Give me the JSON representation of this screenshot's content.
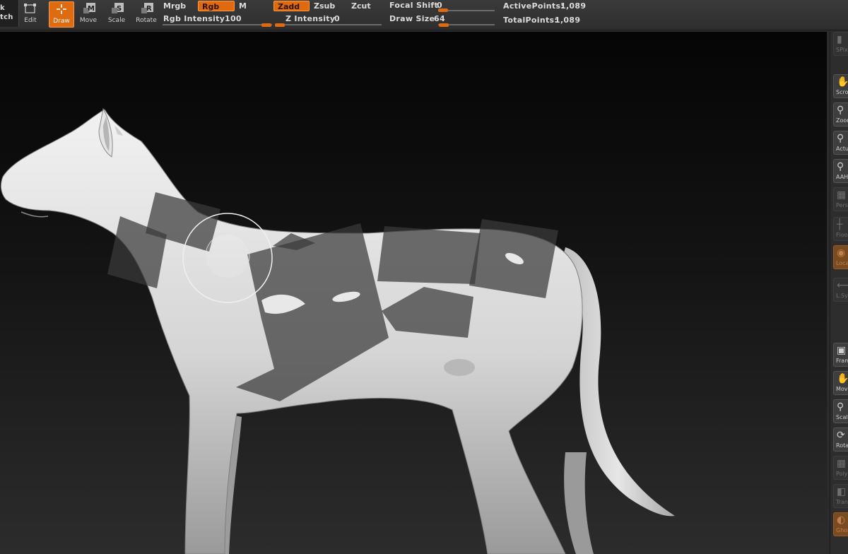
{
  "toolbar": {
    "lightbox_partial": "k",
    "sketch_partial": "tch",
    "tools": [
      {
        "label": "Edit",
        "active": false
      },
      {
        "label": "Draw",
        "active": true
      },
      {
        "label": "Move",
        "letter": "M",
        "active": false
      },
      {
        "label": "Scale",
        "letter": "S",
        "active": false
      },
      {
        "label": "Rotate",
        "letter": "R",
        "active": false
      }
    ],
    "mrgb": "Mrgb",
    "rgb": "Rgb",
    "m": "M",
    "zadd": "Zadd",
    "zsub": "Zsub",
    "zcut": "Zcut",
    "rgb_intensity": {
      "label": "Rgb  Intensity",
      "value": "100",
      "fraction": 1.0
    },
    "z_intensity": {
      "label": "Z  Intensity",
      "value": "0",
      "fraction": 0.0
    },
    "focal_shift": {
      "label": "Focal  Shift",
      "value": "0",
      "fraction": 0.0
    },
    "draw_size": {
      "label": "Draw  Size",
      "value": "64",
      "fraction": 0.05
    },
    "active_points": {
      "label": "ActivePoints:",
      "value": "1,089"
    },
    "total_points": {
      "label": "TotalPoints:",
      "value": "1,089"
    }
  },
  "right_shelf": {
    "items": [
      {
        "label": "SPix",
        "icon": "spix-icon",
        "state": "dim"
      },
      {
        "label": "Scroll",
        "icon": "hand-icon",
        "state": "normal"
      },
      {
        "label": "Zoom",
        "icon": "magnifier-icon",
        "state": "normal"
      },
      {
        "label": "Actual",
        "icon": "magnifier-icon",
        "state": "normal"
      },
      {
        "label": "AAHalf",
        "icon": "magnifier-icon",
        "state": "normal"
      },
      {
        "label": "Persp",
        "icon": "grid-icon",
        "state": "dim"
      },
      {
        "label": "Floor",
        "icon": "floor-icon",
        "state": "dim"
      },
      {
        "label": "Local",
        "icon": "local-icon",
        "state": "orange"
      },
      {
        "label": "L.Sym",
        "icon": "symmetry-icon",
        "state": "dim"
      },
      {
        "label": "Frame",
        "icon": "frame-icon",
        "state": "normal"
      },
      {
        "label": "Move",
        "icon": "hand-icon",
        "state": "normal"
      },
      {
        "label": "Scale",
        "icon": "magnifier-icon",
        "state": "normal"
      },
      {
        "label": "Rotate",
        "icon": "rotate-icon",
        "state": "normal"
      },
      {
        "label": "PolyF",
        "icon": "grid-icon",
        "state": "dim"
      },
      {
        "label": "Transp",
        "icon": "transp-icon",
        "state": "dim"
      },
      {
        "label": "Ghost",
        "icon": "ghost-icon",
        "state": "orange"
      }
    ]
  },
  "colors": {
    "accent": "#e06a10",
    "panel": "#2e2e2e",
    "model": "#d8d8d8"
  }
}
